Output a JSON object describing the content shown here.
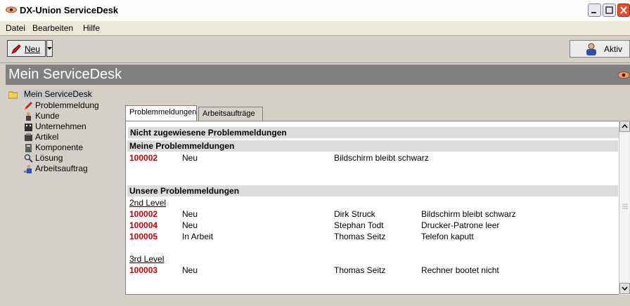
{
  "window": {
    "title": "DX-Union ServiceDesk"
  },
  "menu": [
    "Datei",
    "Bearbeiten",
    "Hilfe"
  ],
  "toolbar": {
    "neu_label": "Neu",
    "aktiv_label": "Aktiv"
  },
  "header": {
    "title": "Mein ServiceDesk"
  },
  "tree": {
    "root": "Mein ServiceDesk",
    "items": [
      "Problemmeldung",
      "Kunde",
      "Unternehmen",
      "Artikel",
      "Komponente",
      "Lösung",
      "Arbeitsauftrag"
    ]
  },
  "tabs": [
    "Problemmeldungen",
    "Arbeitsaufträge"
  ],
  "sections": {
    "unassigned": {
      "title": "Nicht zugewiesene Problemmeldungen"
    },
    "mine": {
      "title": "Meine Problemmeldungen",
      "rows": [
        {
          "id": "100002",
          "status": "Neu",
          "subject": "Bildschirm bleibt schwarz"
        }
      ]
    },
    "ours": {
      "title": "Unsere Problemmeldungen",
      "groups": [
        {
          "label": "2nd Level",
          "rows": [
            {
              "id": "100002",
              "status": "Neu",
              "person": "Dirk Struck",
              "subject": "Bildschirm bleibt schwarz"
            },
            {
              "id": "100004",
              "status": "Neu",
              "person": "Stephan Todt",
              "subject": "Drucker-Patrone leer"
            },
            {
              "id": "100005",
              "status": "In Arbeit",
              "person": "Thomas Seitz",
              "subject": "Telefon kaputt"
            }
          ]
        },
        {
          "label": "3rd Level",
          "rows": [
            {
              "id": "100003",
              "status": "Neu",
              "person": "Thomas Seitz",
              "subject": "Rechner bootet nicht"
            }
          ]
        }
      ]
    }
  },
  "colors": {
    "id_red": "#cc0000",
    "header_gray": "#808080",
    "section_gray": "#dcdcdc"
  }
}
